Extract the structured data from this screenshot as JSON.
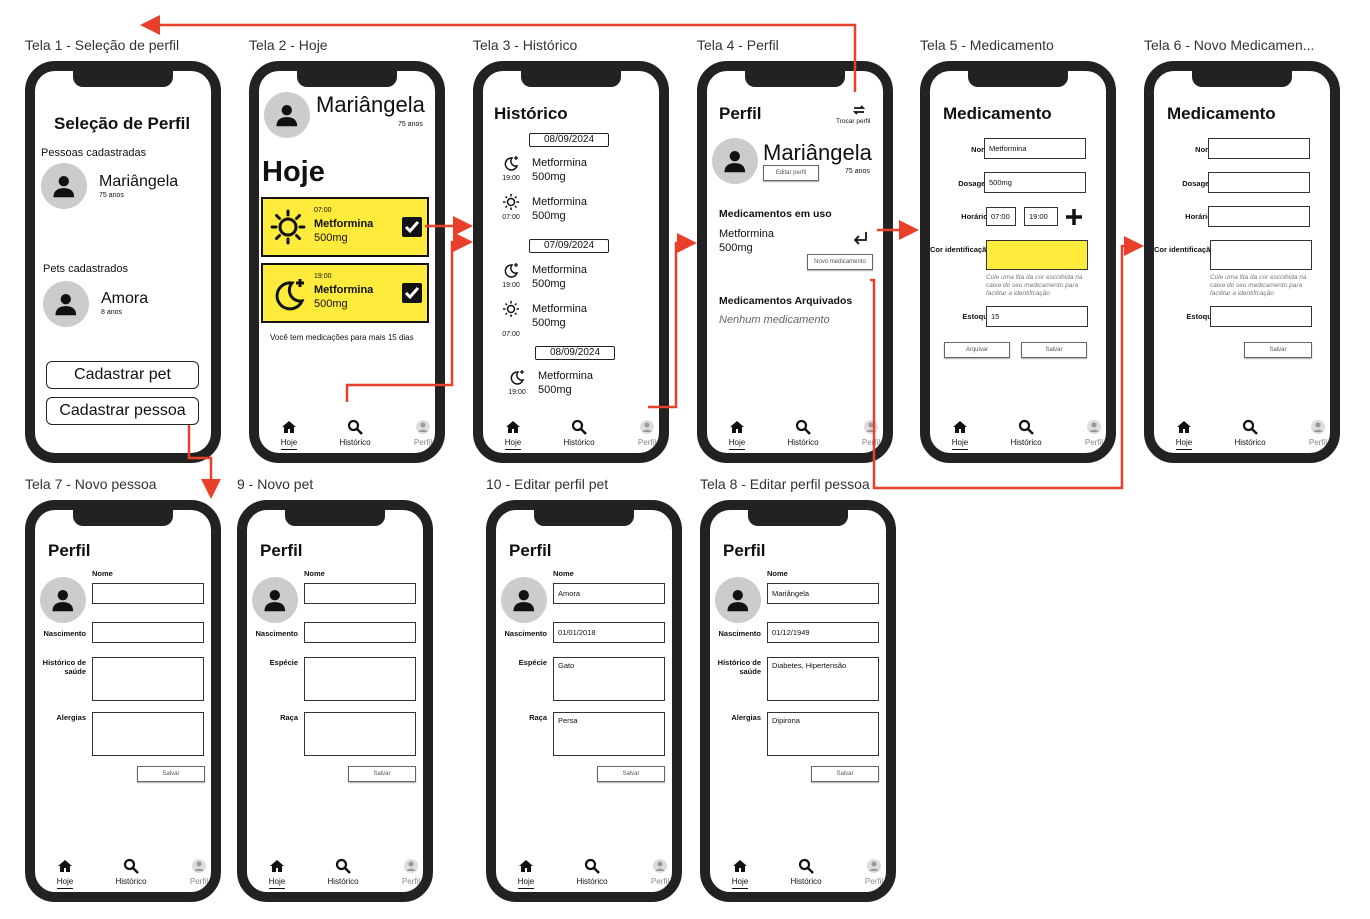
{
  "screen_titles": {
    "t1": "Tela 1 - Seleção de perfil",
    "t2": "Tela 2 - Hoje",
    "t3": "Tela 3 - Histórico",
    "t4": "Tela 4 - Perfil",
    "t5": "Tela 5 - Medicamento",
    "t6": "Tela 6 - Novo Medicamen...",
    "t7": "Tela 7 - Novo pessoa",
    "t9": "9 - Novo pet",
    "t10": "10 - Editar perfil pet",
    "t8": "Tela 8 - Editar perfil pessoa"
  },
  "nav": {
    "hoje": "Hoje",
    "historico": "Histórico",
    "perfil": "Perfil"
  },
  "s1": {
    "title": "Seleção de Perfil",
    "people_header": "Pessoas cadastradas",
    "person_name": "Mariângela",
    "person_age": "75 anos",
    "pets_header": "Pets cadastrados",
    "pet_name": "Amora",
    "pet_age": "8 anos",
    "btn_pet": "Cadastrar pet",
    "btn_person": "Cadastrar pessoa"
  },
  "s2": {
    "name": "Mariângela",
    "age": "75 anos",
    "title": "Hoje",
    "card1_time": "07:00",
    "card1_med": "Metformina",
    "card1_dose": "500mg",
    "card2_time": "19:00",
    "card2_med": "Metformina",
    "card2_dose": "500mg",
    "footer": "Você tem medicações para mais 15 dias"
  },
  "s3": {
    "title": "Histórico",
    "date1": "08/09/2024",
    "date2": "07/09/2024",
    "date3": "08/09/2024",
    "med": "Metformina",
    "dose": "500mg",
    "t_night": "19:00",
    "t_morning": "07:00"
  },
  "s4": {
    "title": "Perfil",
    "swap": "Trocar perfil",
    "name": "Mariângela",
    "edit": "Editar perfil",
    "age": "75 anos",
    "in_use": "Medicamentos em uso",
    "med": "Metformina",
    "dose": "500mg",
    "new_med": "Novo medicamento",
    "archived": "Medicamentos Arquivados",
    "none": "Nenhum medicamento"
  },
  "s5": {
    "title": "Medicamento",
    "l_nome": "Nome",
    "v_nome": "Metformina",
    "l_dos": "Dosagem",
    "v_dos": "500mg",
    "l_hor": "Horários",
    "v_h1": "07:00",
    "v_h2": "19:00",
    "l_cor": "Cor identificação",
    "note": "Cole uma fita da cor escolhida na caixa do seu medicamento para facilitar a identificação",
    "l_est": "Estoque",
    "v_est": "15",
    "btn_arch": "Arquivar",
    "btn_save": "Salvar",
    "color": "#ffeb3b"
  },
  "s6": {
    "title": "Medicamento",
    "l_nome": "Nome",
    "l_dos": "Dosagem",
    "l_hor": "Horários",
    "l_cor": "Cor identificação",
    "note": "Cole uma fita da cor escolhida na caixa do seu medicamento para facilitar a identificação",
    "l_est": "Estoque",
    "btn_save": "Salvar"
  },
  "s7": {
    "title": "Perfil",
    "l_nome": "Nome",
    "l_nasc": "Nascimento",
    "l_hist": "Histórico de saúde",
    "l_alerg": "Alergias",
    "btn_save": "Salvar"
  },
  "s9": {
    "title": "Perfil",
    "l_nome": "Nome",
    "l_nasc": "Nascimento",
    "l_esp": "Espécie",
    "l_raca": "Raça",
    "btn_save": "Salvar"
  },
  "s10": {
    "title": "Perfil",
    "l_nome": "Nome",
    "v_nome": "Amora",
    "l_nasc": "Nascimento",
    "v_nasc": "01/01/2018",
    "l_esp": "Espécie",
    "v_esp": "Gato",
    "l_raca": "Raça",
    "v_raca": "Persa",
    "btn_save": "Salvar"
  },
  "s8": {
    "title": "Perfil",
    "l_nome": "Nome",
    "v_nome": "Mariângela",
    "l_nasc": "Nascimento",
    "v_nasc": "01/12/1949",
    "l_hist": "Histórico de saúde",
    "v_hist": "Diabetes, Hipertensão",
    "l_alerg": "Alergias",
    "v_alerg": "Dipirona",
    "btn_save": "Salvar"
  },
  "colors": {
    "accent": "#e8402a",
    "highlight": "#ffeb3b",
    "frame": "#222222"
  }
}
